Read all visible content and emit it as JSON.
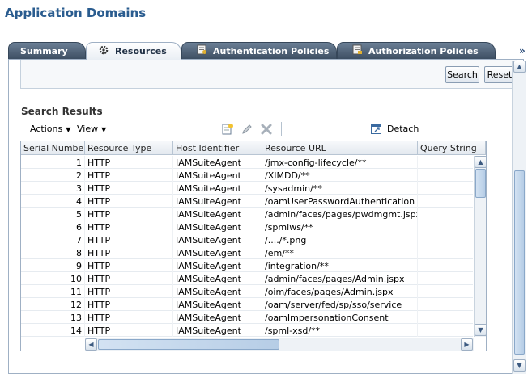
{
  "page": {
    "title": "Application Domains"
  },
  "tabs": [
    {
      "label": "Summary",
      "icon": "none",
      "active": false
    },
    {
      "label": "Resources",
      "icon": "gear-icon",
      "active": true
    },
    {
      "label": "Authentication Policies",
      "icon": "authentication-policy-icon",
      "active": false
    },
    {
      "label": "Authorization Policies",
      "icon": "authorization-policy-icon",
      "active": false
    }
  ],
  "tab_overflow": "»",
  "search": {
    "search_label": "Search",
    "reset_label": "Reset"
  },
  "results": {
    "title": "Search Results",
    "toolbar": {
      "actions_label": "Actions",
      "view_label": "View",
      "detach_label": "Detach",
      "icons": [
        "create-icon",
        "edit-icon",
        "delete-icon",
        "detach-icon"
      ]
    },
    "columns": [
      "Serial Number",
      "Resource Type",
      "Host Identifier",
      "Resource URL",
      "Query String"
    ],
    "rows": [
      [
        "1",
        "HTTP",
        "IAMSuiteAgent",
        "/jmx-config-lifecycle/**",
        ""
      ],
      [
        "2",
        "HTTP",
        "IAMSuiteAgent",
        "/XIMDD/**",
        ""
      ],
      [
        "3",
        "HTTP",
        "IAMSuiteAgent",
        "/sysadmin/**",
        ""
      ],
      [
        "4",
        "HTTP",
        "IAMSuiteAgent",
        "/oamUserPasswordAuthentication",
        ""
      ],
      [
        "5",
        "HTTP",
        "IAMSuiteAgent",
        "/admin/faces/pages/pwdmgmt.jspx",
        ""
      ],
      [
        "6",
        "HTTP",
        "IAMSuiteAgent",
        "/spmlws/**",
        ""
      ],
      [
        "7",
        "HTTP",
        "IAMSuiteAgent",
        "/..../*.png",
        ""
      ],
      [
        "8",
        "HTTP",
        "IAMSuiteAgent",
        "/em/**",
        ""
      ],
      [
        "9",
        "HTTP",
        "IAMSuiteAgent",
        "/integration/**",
        ""
      ],
      [
        "10",
        "HTTP",
        "IAMSuiteAgent",
        "/admin/faces/pages/Admin.jspx",
        ""
      ],
      [
        "11",
        "HTTP",
        "IAMSuiteAgent",
        "/oim/faces/pages/Admin.jspx",
        ""
      ],
      [
        "12",
        "HTTP",
        "IAMSuiteAgent",
        "/oam/server/fed/sp/sso/service",
        ""
      ],
      [
        "13",
        "HTTP",
        "IAMSuiteAgent",
        "/oamImpersonationConsent",
        ""
      ],
      [
        "14",
        "HTTP",
        "IAMSuiteAgent",
        "/spml-xsd/**",
        ""
      ]
    ]
  },
  "colors": {
    "title": "#2a5c8f",
    "tab_dark": "#3d4e62",
    "border": "#9fb0c4"
  }
}
